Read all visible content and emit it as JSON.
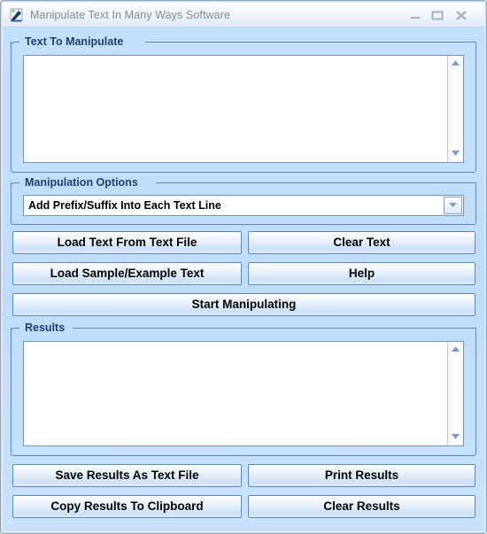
{
  "window": {
    "title": "Manipulate Text In Many Ways Software",
    "icon": "app-wand-icon",
    "controls": {
      "minimize": "minimize-icon",
      "maximize": "maximize-icon",
      "close": "close-icon"
    }
  },
  "colors": {
    "client_bg": "#c4dffc",
    "group_border": "#5f86b5",
    "group_label_text": "#1f3f70",
    "button_text": "#000000",
    "title_text": "#7e8a98",
    "field_border": "#6e97c4",
    "field_bg": "#ffffff"
  },
  "groups": {
    "text_to_manipulate": {
      "label": "Text To Manipulate",
      "textarea": {
        "name": "text-to-manipulate-textarea",
        "value": "",
        "placeholder": ""
      }
    },
    "manipulation_options": {
      "label": "Manipulation Options",
      "combo": {
        "name": "manipulation-options-combo",
        "selected": "Add Prefix/Suffix Into Each Text Line",
        "arrow_icon": "chevron-down-icon"
      }
    },
    "results": {
      "label": "Results",
      "textarea": {
        "name": "results-textarea",
        "value": "",
        "placeholder": ""
      }
    }
  },
  "buttons": {
    "load_text_from_file": "Load Text From Text File",
    "clear_text": "Clear Text",
    "load_sample_text": "Load Sample/Example Text",
    "help": "Help",
    "start_manipulating": "Start Manipulating",
    "save_results_as_text_file": "Save Results As Text File",
    "print_results": "Print Results",
    "copy_results_to_clipboard": "Copy Results To Clipboard",
    "clear_results": "Clear Results"
  },
  "scrollbars": {
    "up_arrow_icon": "triangle-up-icon",
    "down_arrow_icon": "triangle-down-icon"
  }
}
